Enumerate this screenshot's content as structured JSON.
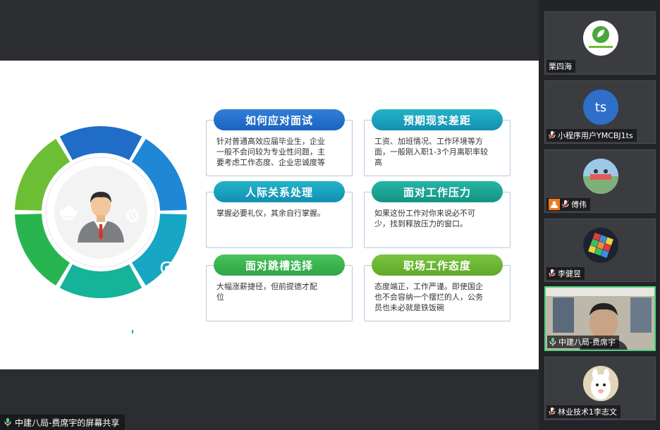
{
  "slide": {
    "cards": [
      {
        "title": "如何应对面试",
        "body_lines": [
          "针对普通高效应届毕业生，企业",
          "一般不会问较为专业性问题，主",
          "要考虑工作态度、企业忠诚度等"
        ]
      },
      {
        "title": "预期现实差距",
        "body_lines": [
          "工资、加班情况、工作环境等方",
          "面，一般刚入职1-3个月离职率较",
          "高"
        ]
      },
      {
        "title": "人际关系处理",
        "body_lines": [
          "掌握必要礼仪，其余自行掌握。"
        ]
      },
      {
        "title": "面对工作压力",
        "body_lines": [
          "如果这份工作对你来说必不可",
          "少，找到释放压力的窗口。"
        ]
      },
      {
        "title": "面对跳槽选择",
        "body_lines": [
          "大幅涨薪捷径，但前提德才配",
          "位"
        ]
      },
      {
        "title": "职场工作态度",
        "body_lines": [
          "态度端正，工作严谨。即使国企",
          "也不会容纳一个摆烂的人，公务",
          "员也未必就是铁饭碗"
        ]
      }
    ],
    "wheel_icons": [
      "coins-icon",
      "gear-icon",
      "location-icon",
      "lock-icon",
      "bar-chart-icon",
      "cloud-icon"
    ],
    "wheel_colors": [
      "#1f6dc7",
      "#1e87d6",
      "#17a6c4",
      "#15b39a",
      "#28b550",
      "#6cbf35"
    ]
  },
  "share_label": "中建八局-费席宇的屏幕共享",
  "participants": [
    {
      "name": "栗四海",
      "avatar": "logo",
      "muted": false
    },
    {
      "name": "小程序用户YMCBJ1ts",
      "avatar": "ts",
      "muted": true
    },
    {
      "name": "傅伟",
      "avatar": "photo",
      "muted": false
    },
    {
      "name": "李健昱",
      "avatar": "cube",
      "muted": true
    },
    {
      "name": "中建八局-费席宇",
      "avatar": "video",
      "muted": false
    },
    {
      "name": "林业技术1李志文",
      "avatar": "alpaca",
      "muted": true
    }
  ],
  "avatar_initials": "ts"
}
